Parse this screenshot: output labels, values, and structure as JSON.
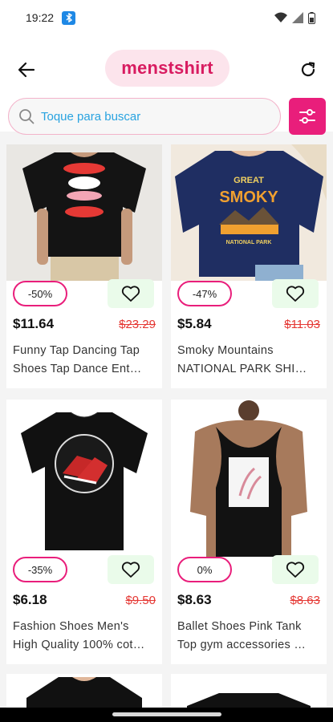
{
  "status_bar": {
    "time": "19:22"
  },
  "header": {
    "title": "menstshirt"
  },
  "search": {
    "placeholder": "Toque para buscar"
  },
  "products": [
    {
      "discount": "-50%",
      "price": "$11.64",
      "old_price": "$23.29",
      "name_line1": "Funny Tap Dancing Tap",
      "name_line2": "Shoes Tap Dance Ent…",
      "image_alt": "black t-shirt with tap shoes print"
    },
    {
      "discount": "-47%",
      "price": "$5.84",
      "old_price": "$11.03",
      "name_line1": "Smoky Mountains",
      "name_line2": "NATIONAL PARK SHI…",
      "image_alt": "navy t-shirt with Great Smoky Mountains print"
    },
    {
      "discount": "-35%",
      "price": "$6.18",
      "old_price": "$9.50",
      "name_line1": "Fashion Shoes Men's",
      "name_line2": "High Quality 100% cot…",
      "image_alt": "black t-shirt with red sneakers print"
    },
    {
      "discount": "0%",
      "price": "$8.63",
      "old_price": "$8.63",
      "name_line1": "Ballet Shoes Pink Tank",
      "name_line2": "Top gym accessories …",
      "image_alt": "black tank top with ballet shoes print"
    }
  ],
  "icons": {
    "back": "arrow-left-icon",
    "refresh": "refresh-icon",
    "search": "search-icon",
    "filter": "sliders-icon",
    "favorite": "heart-outline-icon"
  },
  "colors": {
    "accent": "#e91e7b",
    "title_text": "#d81b60",
    "title_bg": "#fce4ec",
    "search_placeholder": "#29a3e0",
    "old_price": "#e53935",
    "fav_bg": "#eafbea"
  }
}
